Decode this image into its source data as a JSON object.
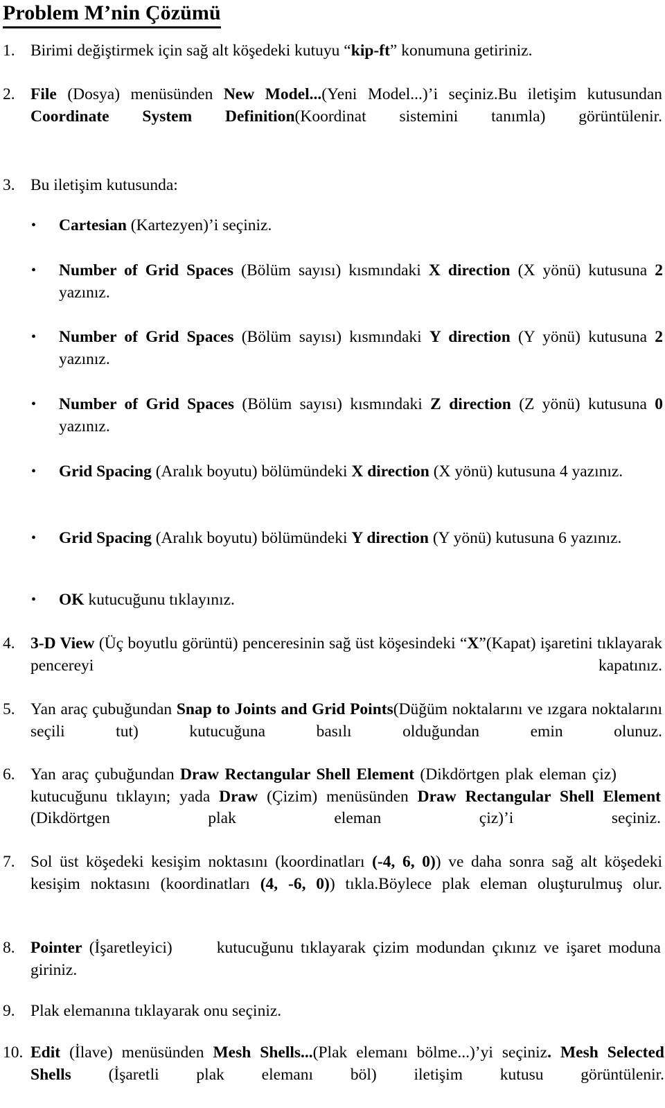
{
  "document": {
    "title": "Problem M’nin Çözümü",
    "language": "tr",
    "items": [
      {
        "number": "1.",
        "kind": "numbered",
        "segments": [
          {
            "t": "Birimi değiştirmek için sağ alt köşedeki kutuyu “",
            "b": false
          },
          {
            "t": "kip-ft",
            "b": true
          },
          {
            "t": "” konumuna getiriniz.",
            "b": false
          }
        ],
        "plain": "Birimi değiştirmek için sağ alt köşedeki kutuyu “kip-ft” konumuna getiriniz."
      },
      {
        "number": "2.",
        "kind": "numbered",
        "segments": [
          {
            "t": "File",
            "b": true
          },
          {
            "t": " (Dosya) menüsünden ",
            "b": false
          },
          {
            "t": "New Model...",
            "b": true
          },
          {
            "t": "(Yeni Model...)’i seçiniz.Bu iletişim kutusundan ",
            "b": false
          },
          {
            "t": "Coordinate System Definition",
            "b": true
          },
          {
            "t": "(Koordinat sistemini tanımla) görüntülenir.",
            "b": false
          }
        ],
        "plain": "File (Dosya) menüsünden New Model...(Yeni Model...)’i seçiniz.Bu iletişim kutusundan Coordinate System Definition(Koordinat sistemini tanımla) görüntülenir."
      },
      {
        "number": "3.",
        "kind": "numbered",
        "segments": [
          {
            "t": "Bu iletişim kutusunda:",
            "b": false
          }
        ],
        "plain": "Bu iletişim kutusunda:"
      },
      {
        "number": "•",
        "kind": "bullet",
        "segments": [
          {
            "t": "Cartesian",
            "b": true
          },
          {
            "t": " (Kartezyen)’i seçiniz.",
            "b": false
          }
        ],
        "plain": "Cartesian (Kartezyen)’i seçiniz."
      },
      {
        "number": "•",
        "kind": "bullet",
        "segments": [
          {
            "t": "Number of Grid Spaces",
            "b": true
          },
          {
            "t": " (Bölüm sayısı) kısmındaki  ",
            "b": false
          },
          {
            "t": "X direction",
            "b": true
          },
          {
            "t": " (X yönü) kutusuna ",
            "b": false
          },
          {
            "t": "2",
            "b": true
          },
          {
            "t": " yazınız.",
            "b": false
          }
        ],
        "plain": "Number of Grid Spaces (Bölüm sayısı) kısmındaki X direction (X yönü) kutusuna 2 yazınız."
      },
      {
        "number": "•",
        "kind": "bullet",
        "segments": [
          {
            "t": "Number of Grid Spaces",
            "b": true
          },
          {
            "t": " (Bölüm sayısı) kısmındaki  ",
            "b": false
          },
          {
            "t": "Y direction",
            "b": true
          },
          {
            "t": " (Y yönü) kutusuna ",
            "b": false
          },
          {
            "t": "2",
            "b": true
          },
          {
            "t": " yazınız.",
            "b": false
          }
        ],
        "plain": "Number of Grid Spaces (Bölüm sayısı) kısmındaki Y direction (Y yönü) kutusuna 2 yazınız."
      },
      {
        "number": "•",
        "kind": "bullet",
        "segments": [
          {
            "t": "Number of Grid Spaces",
            "b": true
          },
          {
            "t": " (Bölüm sayısı) kısmındaki  ",
            "b": false
          },
          {
            "t": "Z direction",
            "b": true
          },
          {
            "t": " (Z yönü) kutusuna ",
            "b": false
          },
          {
            "t": "0",
            "b": true
          },
          {
            "t": " yazınız.",
            "b": false
          }
        ],
        "plain": "Number of Grid Spaces (Bölüm sayısı) kısmındaki Z direction (Z yönü) kutusuna 0 yazınız."
      },
      {
        "number": "•",
        "kind": "bullet",
        "segments": [
          {
            "t": "Grid Spacing",
            "b": true
          },
          {
            "t": " (Aralık boyutu) bölümündeki ",
            "b": false
          },
          {
            "t": "X direction",
            "b": true
          },
          {
            "t": "  (X yönü) kutusuna  ",
            "b": false
          },
          {
            "t": "4",
            "b": false
          },
          {
            "t": " yazınız.",
            "b": false
          }
        ],
        "plain": "Grid Spacing (Aralık boyutu) bölümündeki X direction (X yönü) kutusuna 4 yazınız."
      },
      {
        "number": "•",
        "kind": "bullet",
        "segments": [
          {
            "t": "Grid Spacing",
            "b": true
          },
          {
            "t": " (Aralık boyutu) bölümündeki ",
            "b": false
          },
          {
            "t": "Y direction",
            "b": true
          },
          {
            "t": "  (Y yönü) kutusuna 6 yazınız.",
            "b": false
          }
        ],
        "plain": "Grid Spacing (Aralık boyutu) bölümündeki Y direction (Y yönü) kutusuna 6 yazınız."
      },
      {
        "number": "•",
        "kind": "bullet",
        "segments": [
          {
            "t": "OK",
            "b": true
          },
          {
            "t": " kutucuğunu tıklayınız.",
            "b": false
          }
        ],
        "plain": "OK kutucuğunu tıklayınız."
      },
      {
        "number": "4.",
        "kind": "numbered",
        "segments": [
          {
            "t": "3-D View",
            "b": true
          },
          {
            "t": " (Üç boyutlu görüntü) penceresinin sağ üst köşesindeki “",
            "b": false
          },
          {
            "t": "X",
            "b": true
          },
          {
            "t": "”(Kapat) işaretini tıklayarak pencereyi kapatınız.",
            "b": false
          }
        ],
        "plain": "3-D View (Üç boyutlu görüntü) penceresinin sağ üst köşesindeki “X”(Kapat) işaretini tıklayarak pencereyi kapatınız."
      },
      {
        "number": "5.",
        "kind": "numbered",
        "segments": [
          {
            "t": "Yan araç çubuğundan  ",
            "b": false
          },
          {
            "t": "Snap to Joints and Grid Points",
            "b": true
          },
          {
            "t": "(Düğüm noktalarını ve ızgara noktalarını seçili tut) kutucuğuna basılı olduğundan emin olunuz.",
            "b": false
          }
        ],
        "plain": "Yan araç çubuğundan Snap to Joints and Grid Points(Düğüm noktalarını ve ızgara noktalarını seçili tut) kutucuğuna basılı olduğundan emin olunuz."
      },
      {
        "number": "6.",
        "kind": "numbered",
        "segments": [
          {
            "t": "Yan araç çubuğundan ",
            "b": false
          },
          {
            "t": "Draw Rectangular Shell Element",
            "b": true
          },
          {
            "t": " (Dikdörtgen plak eleman çiz)",
            "b": false
          },
          {
            "t": "GAP",
            "b": false
          },
          {
            "t": "kutucuğunu tıklayın; yada ",
            "b": false
          },
          {
            "t": "Draw",
            "b": true
          },
          {
            "t": " (Çizim) menüsünden ",
            "b": false
          },
          {
            "t": "Draw Rectangular Shell Element",
            "b": true
          },
          {
            "t": " (Dikdörtgen plak eleman çiz)’i seçiniz.",
            "b": false
          }
        ],
        "plain": "Yan araç çubuğundan Draw Rectangular Shell Element (Dikdörtgen plak eleman çiz) kutucuğunu tıklayın; yada Draw (Çizim) menüsünden Draw Rectangular Shell Element (Dikdörtgen plak eleman çiz)’i seçiniz."
      },
      {
        "number": "7.",
        "kind": "numbered",
        "segments": [
          {
            "t": "Sol üst köşedeki kesişim noktasını (koordinatları  ",
            "b": false
          },
          {
            "t": "(-4, 6, 0)",
            "b": true
          },
          {
            "t": ") ve daha sonra sağ alt köşedeki kesişim noktasını (koordinatları ",
            "b": false
          },
          {
            "t": "(4, -6, 0)",
            "b": true
          },
          {
            "t": ") tıkla.Böylece plak eleman oluşturulmuş olur.",
            "b": false
          }
        ],
        "plain": "Sol üst köşedeki kesişim noktasını (koordinatları (-4, 6, 0)) ve daha sonra sağ alt köşedeki kesişim noktasını (koordinatları (4, -6, 0)) tıkla.Böylece plak eleman oluşturulmuş olur."
      },
      {
        "number": "8.",
        "kind": "numbered",
        "segments": [
          {
            "t": "Pointer",
            "b": true
          },
          {
            "t": " (İşaretleyici)",
            "b": false
          },
          {
            "t": "GAP",
            "b": false
          },
          {
            "t": "kutucuğunu tıklayarak çizim modundan çıkınız ve işaret moduna giriniz.",
            "b": false
          }
        ],
        "plain": "Pointer (İşaretleyici) kutucuğunu tıklayarak çizim modundan çıkınız ve işaret moduna giriniz."
      },
      {
        "number": "9.",
        "kind": "numbered",
        "segments": [
          {
            "t": "Plak elemanına tıklayarak onu seçiniz.",
            "b": false
          }
        ],
        "plain": "Plak elemanına tıklayarak onu seçiniz."
      },
      {
        "number": "10.",
        "kind": "numbered",
        "segments": [
          {
            "t": "Edit",
            "b": true
          },
          {
            "t": " (İlave) menüsünden  ",
            "b": false
          },
          {
            "t": "Mesh Shells...",
            "b": true
          },
          {
            "t": "(Plak elemanı bölme...)’yi seçiniz",
            "b": false
          },
          {
            "t": ". Mesh Selected Shells",
            "b": true
          },
          {
            "t": " (İşaretli plak elemanı böl) iletişim kutusu görüntülenir.",
            "b": false
          }
        ],
        "plain": "Edit (İlave) menüsünden Mesh Shells...(Plak elemanı bölme...)’yi seçiniz. Mesh Selected Shells (İşaretli plak elemanı böl) iletişim kutusu görüntülenir."
      }
    ]
  }
}
